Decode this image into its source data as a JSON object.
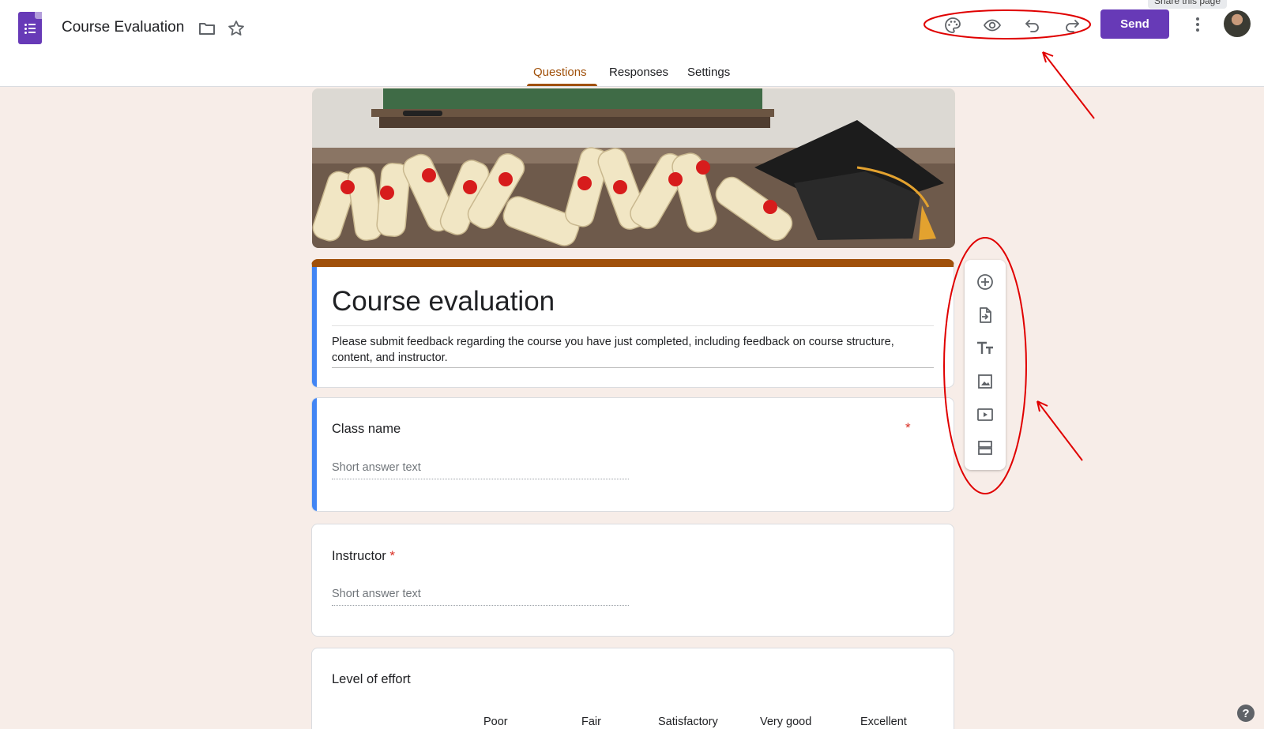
{
  "header": {
    "doc_title": "Course Evaluation",
    "send_label": "Send",
    "tooltip": "Share this page",
    "icons": [
      "forms-logo-icon",
      "folder-icon",
      "star-icon",
      "palette-icon",
      "eye-icon",
      "undo-icon",
      "redo-icon",
      "more-vert-icon"
    ]
  },
  "tabs": [
    {
      "label": "Questions",
      "active": true
    },
    {
      "label": "Responses",
      "active": false
    },
    {
      "label": "Settings",
      "active": false
    }
  ],
  "form": {
    "title": "Course evaluation",
    "description": "Please submit feedback regarding the course you have just completed, including feedback on course structure, content, and instructor."
  },
  "questions": [
    {
      "title": "Class name",
      "required_mark": "*",
      "placeholder": "Short answer text"
    },
    {
      "title": "Instructor",
      "required_mark": "*",
      "placeholder": "Short answer text"
    },
    {
      "title": "Level of effort",
      "columns": [
        "Poor",
        "Fair",
        "Satisfactory",
        "Very good",
        "Excellent"
      ]
    }
  ],
  "side_toolbar": [
    "add-question-icon",
    "import-questions-icon",
    "add-title-icon",
    "add-image-icon",
    "add-video-icon",
    "add-section-icon"
  ],
  "help_label": "?",
  "colors": {
    "accent": "#673ab7",
    "theme": "#a0500a",
    "background": "#f7ede8",
    "focus": "#4285f4",
    "annotation": "#e00000"
  }
}
